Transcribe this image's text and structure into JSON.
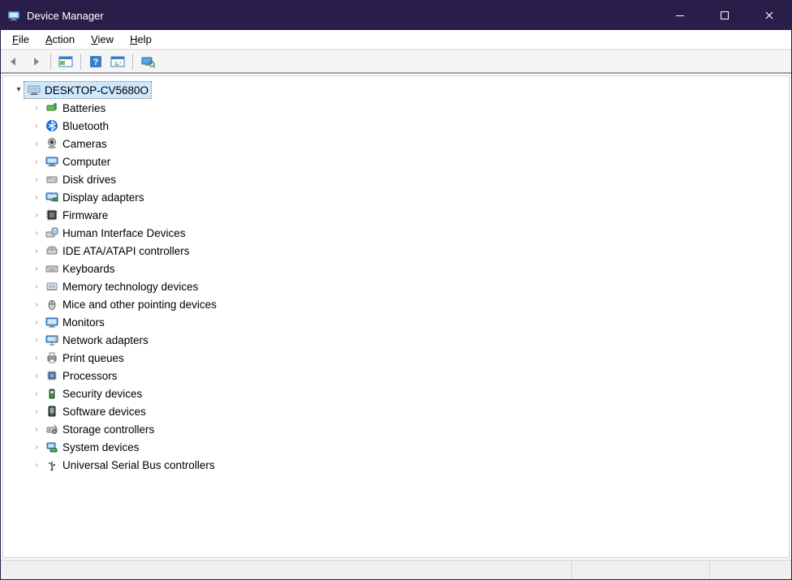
{
  "window": {
    "title": "Device Manager"
  },
  "menu": {
    "file": "File",
    "action": "Action",
    "view": "View",
    "help": "Help"
  },
  "toolbar": {
    "back": "back",
    "forward": "forward",
    "show_hide": "show-hide-console-tree",
    "help": "help",
    "action_menu": "action",
    "monitors_tool": "monitors"
  },
  "tree": {
    "root": {
      "label": "DESKTOP-CV5680O",
      "expanded": true,
      "selected": true,
      "icon": "computer-root-icon"
    },
    "children": [
      {
        "label": "Batteries",
        "icon": "battery-icon"
      },
      {
        "label": "Bluetooth",
        "icon": "bluetooth-icon"
      },
      {
        "label": "Cameras",
        "icon": "camera-icon"
      },
      {
        "label": "Computer",
        "icon": "computer-icon"
      },
      {
        "label": "Disk drives",
        "icon": "disk-icon"
      },
      {
        "label": "Display adapters",
        "icon": "display-adapter-icon"
      },
      {
        "label": "Firmware",
        "icon": "firmware-icon"
      },
      {
        "label": "Human Interface Devices",
        "icon": "hid-icon"
      },
      {
        "label": "IDE ATA/ATAPI controllers",
        "icon": "ide-icon"
      },
      {
        "label": "Keyboards",
        "icon": "keyboard-icon"
      },
      {
        "label": "Memory technology devices",
        "icon": "memory-icon"
      },
      {
        "label": "Mice and other pointing devices",
        "icon": "mouse-icon"
      },
      {
        "label": "Monitors",
        "icon": "monitor-icon"
      },
      {
        "label": "Network adapters",
        "icon": "network-icon"
      },
      {
        "label": "Print queues",
        "icon": "printer-icon"
      },
      {
        "label": "Processors",
        "icon": "processor-icon"
      },
      {
        "label": "Security devices",
        "icon": "security-icon"
      },
      {
        "label": "Software devices",
        "icon": "software-icon"
      },
      {
        "label": "Storage controllers",
        "icon": "storage-icon"
      },
      {
        "label": "System devices",
        "icon": "system-icon"
      },
      {
        "label": "Universal Serial Bus controllers",
        "icon": "usb-icon"
      }
    ]
  }
}
